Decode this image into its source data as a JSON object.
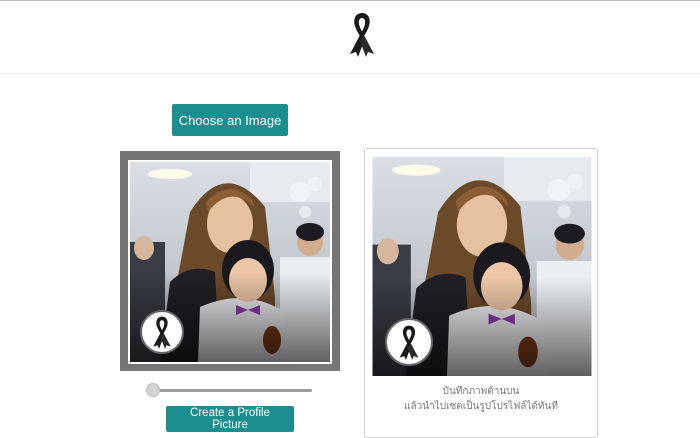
{
  "header": {
    "logo_icon": "black-ribbon-icon"
  },
  "uploader": {
    "choose_label": "Choose an Image"
  },
  "editor": {
    "frame_color": "#757575",
    "badge_icon": "ribbon-badge-icon",
    "zoom_slider": {
      "value_fraction": 0.0
    },
    "create_label": "Create a Profile Picture"
  },
  "preview": {
    "caption_line1": "บันทึกภาพด้านบน",
    "caption_line2": "แล้วนำไปเซตเป็นรูปโปรไฟล์ได้ทันที"
  },
  "colors": {
    "accent": "#1b8f8f",
    "frame": "#757575"
  }
}
